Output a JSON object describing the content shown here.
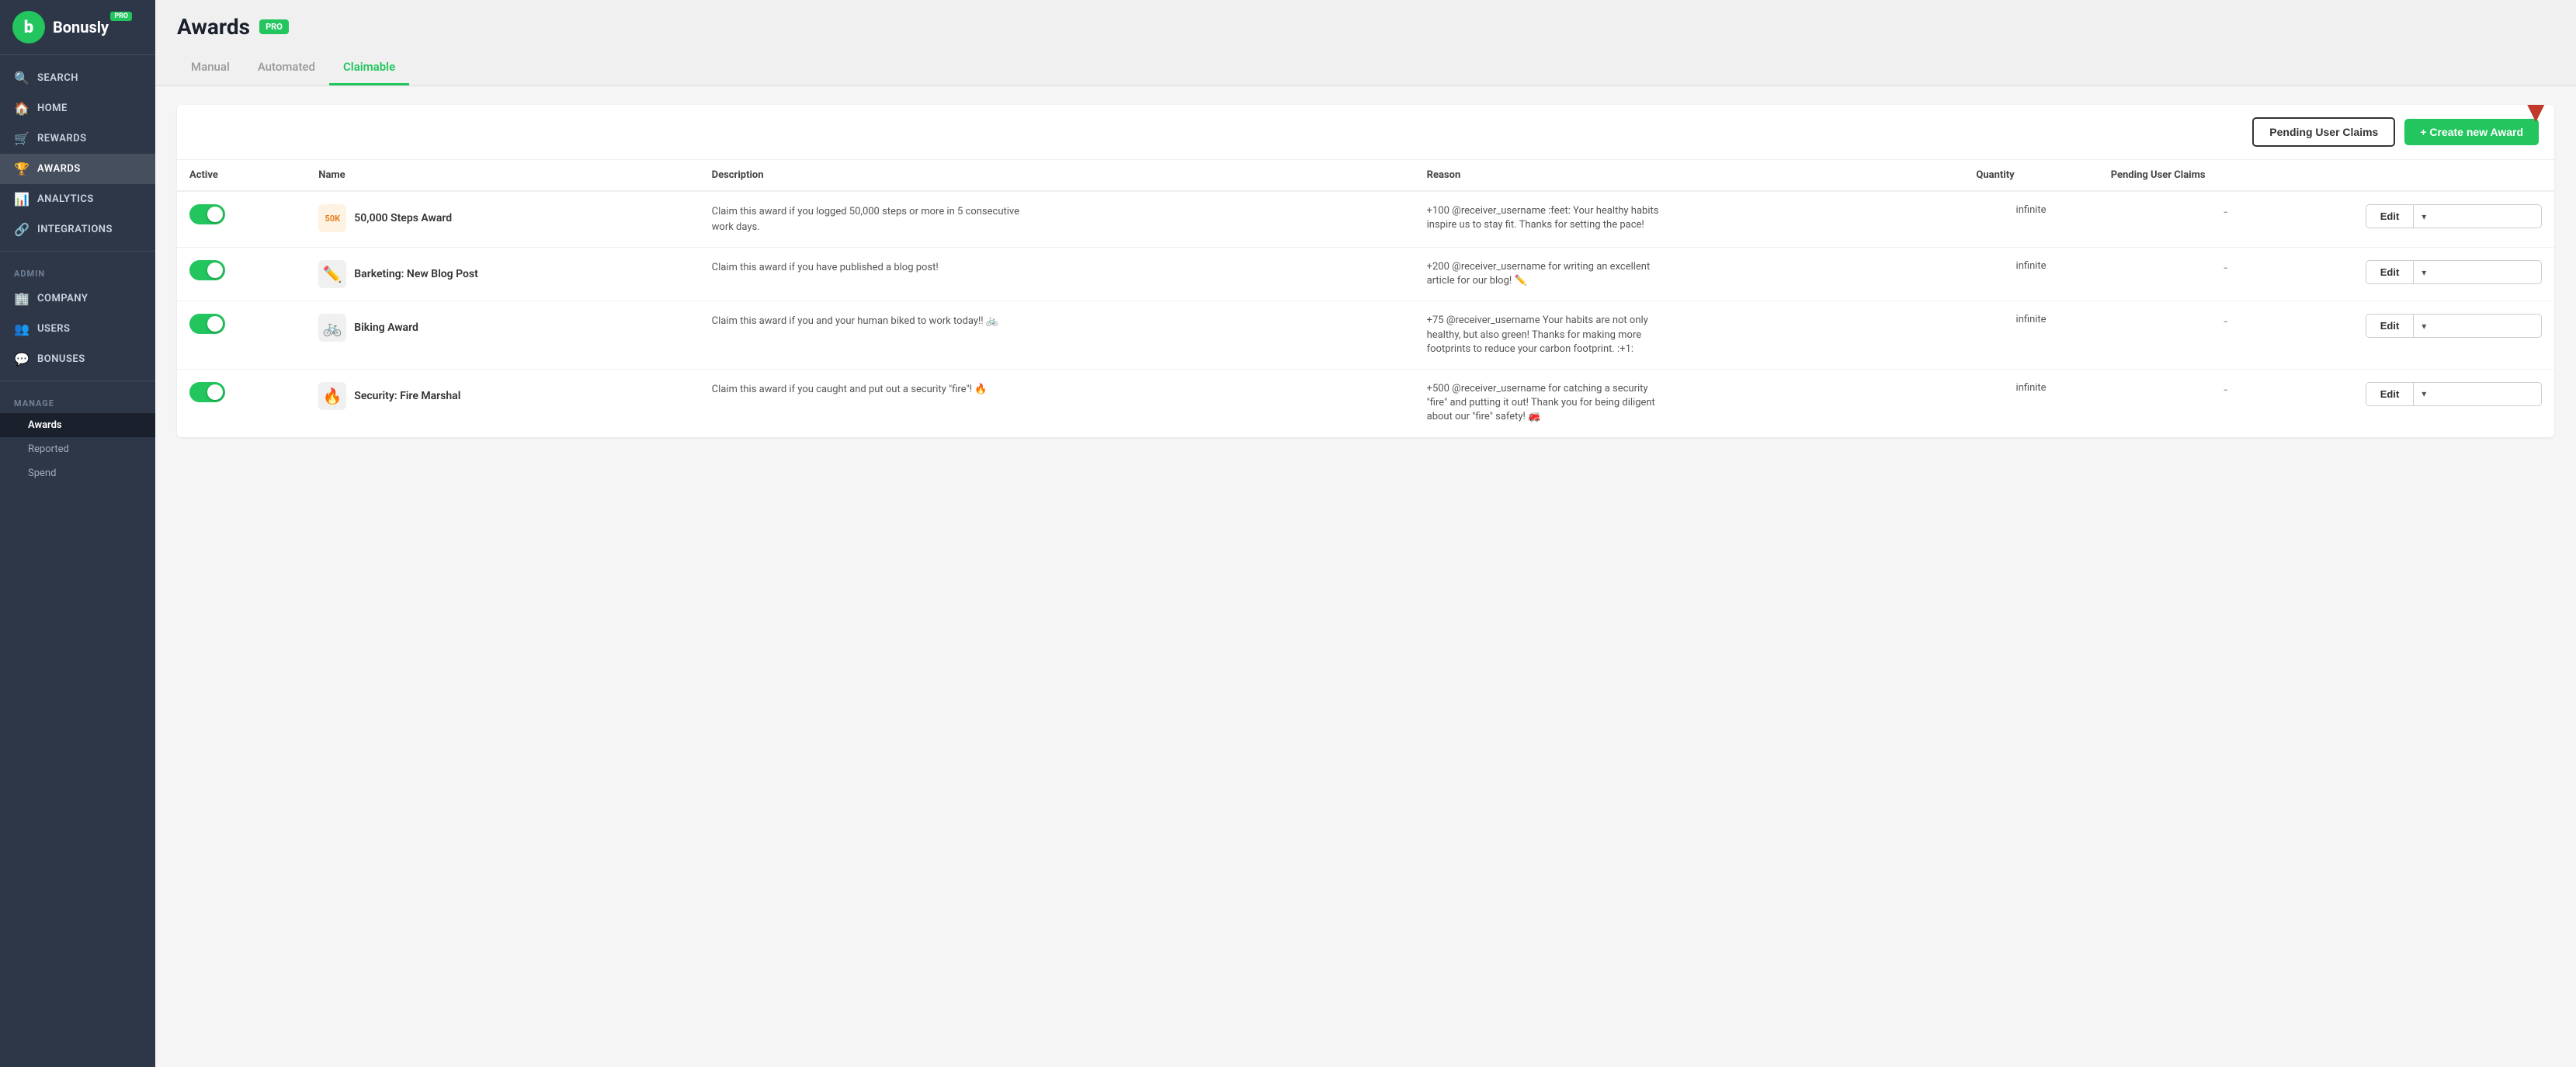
{
  "sidebar": {
    "logo_letter": "b",
    "logo_text": "Bonusly",
    "pro_badge": "PRO",
    "nav_items": [
      {
        "id": "search",
        "label": "Search",
        "icon": "🔍"
      },
      {
        "id": "home",
        "label": "Home",
        "icon": "🏠"
      },
      {
        "id": "rewards",
        "label": "Rewards",
        "icon": "🛒"
      },
      {
        "id": "awards",
        "label": "Awards",
        "icon": "🏆"
      },
      {
        "id": "analytics",
        "label": "Analytics",
        "icon": "📊"
      },
      {
        "id": "integrations",
        "label": "Integrations",
        "icon": "🔗"
      }
    ],
    "admin_label": "Admin",
    "admin_items": [
      {
        "id": "company",
        "label": "Company",
        "icon": "🏢"
      },
      {
        "id": "users",
        "label": "Users",
        "icon": "👥"
      },
      {
        "id": "bonuses",
        "label": "Bonuses",
        "icon": "💬"
      }
    ],
    "manage_label": "Manage",
    "manage_items": [
      {
        "id": "awards-manage",
        "label": "Awards",
        "active": true
      },
      {
        "id": "reported",
        "label": "Reported"
      },
      {
        "id": "spend",
        "label": "Spend"
      }
    ]
  },
  "page": {
    "title": "Awards",
    "pro_badge": "PRO"
  },
  "tabs": [
    {
      "id": "manual",
      "label": "Manual",
      "active": false
    },
    {
      "id": "automated",
      "label": "Automated",
      "active": false
    },
    {
      "id": "claimable",
      "label": "Claimable",
      "active": true
    }
  ],
  "buttons": {
    "pending_claims": "Pending User Claims",
    "create_award": "+ Create new Award"
  },
  "table": {
    "headers": [
      "Active",
      "Name",
      "Description",
      "Reason",
      "Quantity",
      "Pending User Claims"
    ],
    "rows": [
      {
        "active": true,
        "icon": "50K",
        "icon_sub": "⚙",
        "name": "50,000 Steps Award",
        "description": "Claim this award if you logged 50,000 steps or more in 5 consecutive work days.",
        "reason": "+100 @receiver_username :feet: Your healthy habits inspire us to stay fit. Thanks for setting the pace!",
        "quantity": "infinite",
        "pending": "-"
      },
      {
        "active": true,
        "icon": "✏️",
        "name": "Barketing: New Blog Post",
        "description": "Claim this award if you have published a blog post!",
        "reason": "+200 @receiver_username for writing an excellent article for our blog! ✏️",
        "quantity": "infinite",
        "pending": "-"
      },
      {
        "active": true,
        "icon": "🚲",
        "name": "Biking Award",
        "description": "Claim this award if you and your human biked to work today!! 🚲",
        "reason": "+75 @receiver_username Your habits are not only healthy, but also green! Thanks for making more footprints to reduce your carbon footprint. :+1:",
        "quantity": "infinite",
        "pending": "-"
      },
      {
        "active": true,
        "icon": "🔥",
        "name": "Security: Fire Marshal",
        "description": "Claim this award if you caught and put out a security \"fire\"! 🔥",
        "reason": "+500 @receiver_username for catching a security \"fire\" and putting it out! Thank you for being diligent about our \"fire\" safety! 🚒",
        "quantity": "infinite",
        "pending": "-"
      }
    ]
  }
}
